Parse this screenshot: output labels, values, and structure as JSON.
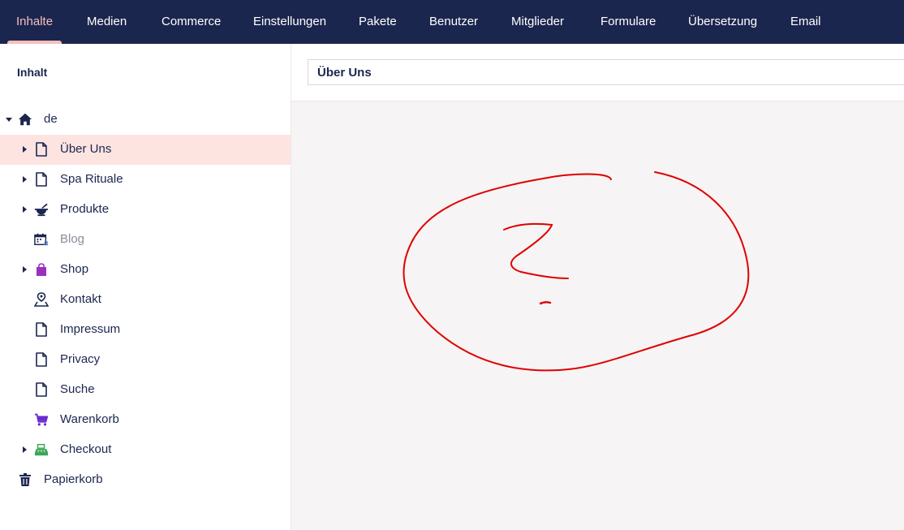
{
  "nav": {
    "items": [
      {
        "label": "Inhalte",
        "active": true
      },
      {
        "label": "Medien"
      },
      {
        "label": "Commerce"
      },
      {
        "label": "Einstellungen"
      },
      {
        "label": "Pakete"
      },
      {
        "label": "Benutzer"
      },
      {
        "label": "Mitglieder"
      },
      {
        "label": "Formulare"
      },
      {
        "label": "Übersetzung"
      },
      {
        "label": "Email"
      }
    ]
  },
  "sidebar": {
    "heading": "Inhalt",
    "root": {
      "label": "de",
      "icon": "home-icon"
    },
    "items": [
      {
        "label": "Über Uns",
        "icon": "document-icon",
        "selected": true
      },
      {
        "label": "Spa Rituale",
        "icon": "document-icon"
      },
      {
        "label": "Produkte",
        "icon": "mortar-pestle-icon"
      },
      {
        "label": "Blog",
        "icon": "calendar-icon",
        "muted": true
      },
      {
        "label": "Shop",
        "icon": "shopping-bag-icon"
      },
      {
        "label": "Kontakt",
        "icon": "map-pin-person-icon"
      },
      {
        "label": "Impressum",
        "icon": "document-icon"
      },
      {
        "label": "Privacy",
        "icon": "document-icon"
      },
      {
        "label": "Suche",
        "icon": "document-icon"
      },
      {
        "label": "Warenkorb",
        "icon": "shopping-cart-icon"
      },
      {
        "label": "Checkout",
        "icon": "cash-register-icon"
      }
    ],
    "trash": {
      "label": "Papierkorb",
      "icon": "trash-icon"
    }
  },
  "editor": {
    "title_value": "Über Uns"
  },
  "colors": {
    "nav_bg": "#1b264f",
    "nav_active": "#f5c1bc",
    "selected_row": "#fde4e1",
    "annotation": "#e00000",
    "shop_icon": "#9b30c0",
    "cart_icon": "#6b2bd0",
    "checkout_icon": "#3aa655"
  },
  "annotation": {
    "shape": "hand-drawn red circle with question mark"
  }
}
